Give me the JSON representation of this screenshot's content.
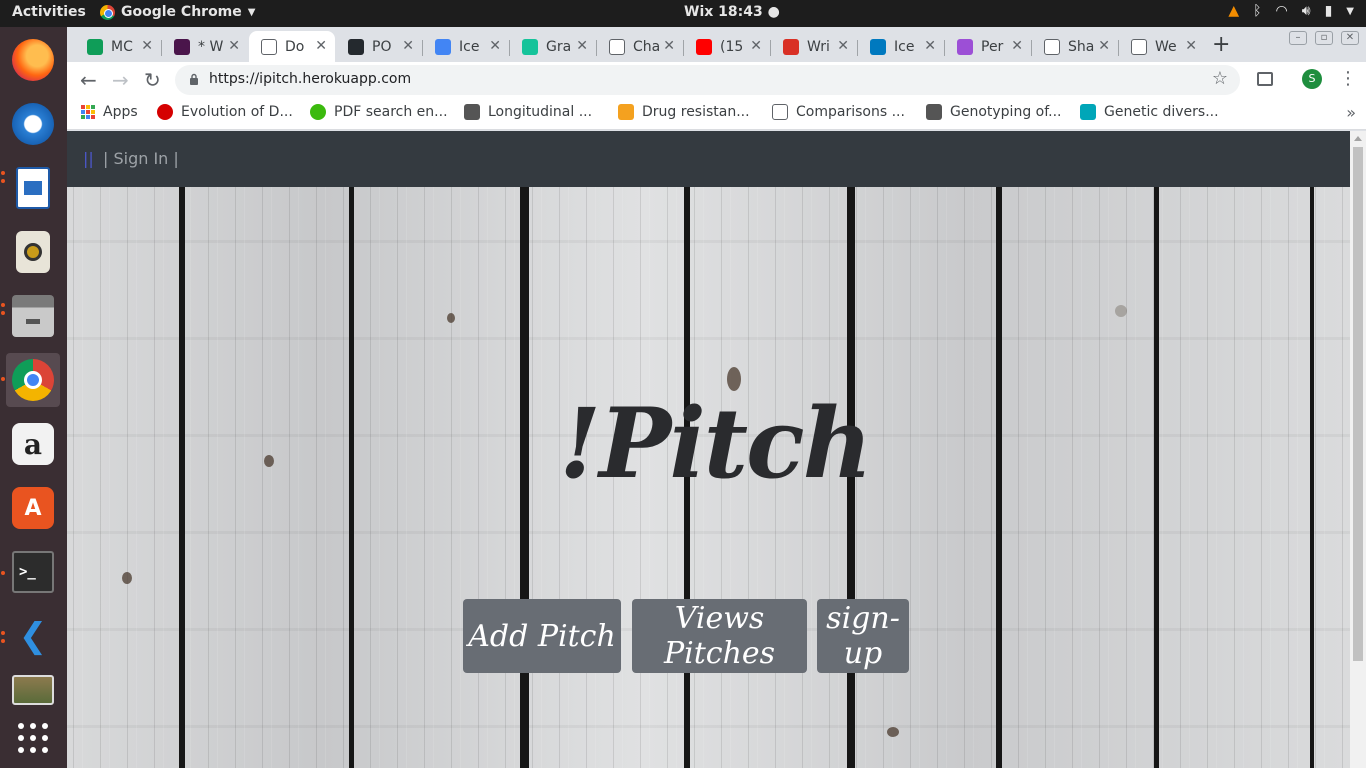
{
  "topbar": {
    "activities": "Activities",
    "app_name": "Google Chrome",
    "clock": "Wix 18:43 ●"
  },
  "dock": {
    "items": [
      "firefox",
      "thunderbird",
      "libreoffice-writer",
      "rhythmbox",
      "files",
      "chrome",
      "amazon",
      "software-center",
      "terminal",
      "vscode",
      "shotwell",
      "show-apps"
    ]
  },
  "tabs": [
    {
      "title": "MC",
      "icon": "green-plus-icon",
      "color": "#0f9d58"
    },
    {
      "title": "* W",
      "icon": "slack-icon",
      "color": "#4a154b"
    },
    {
      "title": "Do",
      "icon": "document-icon",
      "color": "#ffffff",
      "active": true
    },
    {
      "title": "PO",
      "icon": "github-icon",
      "color": "#24292e"
    },
    {
      "title": "Ice",
      "icon": "docs-icon",
      "color": "#4285f4"
    },
    {
      "title": "Gra",
      "icon": "grammarly-icon",
      "color": "#15c39a"
    },
    {
      "title": "Cha",
      "icon": "document-icon",
      "color": "#ffffff"
    },
    {
      "title": "(15",
      "icon": "youtube-icon",
      "color": "#ff0000"
    },
    {
      "title": "Wri",
      "icon": "write-icon",
      "color": "#d93025"
    },
    {
      "title": "Ice",
      "icon": "trello-icon",
      "color": "#0079bf"
    },
    {
      "title": "Per",
      "icon": "h-icon",
      "color": "#9c4fd6"
    },
    {
      "title": "Sha",
      "icon": "document-icon",
      "color": "#ffffff"
    },
    {
      "title": "We",
      "icon": "document-icon",
      "color": "#ffffff"
    }
  ],
  "toolbar": {
    "url": "https://ipitch.herokuapp.com",
    "profile_initial": "S"
  },
  "bookmarks": [
    {
      "label": "Apps",
      "icon": "apps-grid-icon",
      "color": "#ea4335"
    },
    {
      "label": "Evolution of D...",
      "icon": "red-circle-icon",
      "color": "#d50000"
    },
    {
      "label": "PDF search en...",
      "icon": "green-face-icon",
      "color": "#3bba0e"
    },
    {
      "label": "Longitudinal ...",
      "icon": "s-curve-icon",
      "color": "#555555"
    },
    {
      "label": "Drug resistan...",
      "icon": "e-icon",
      "color": "#f4a11f"
    },
    {
      "label": "Comparisons ...",
      "icon": "document-icon",
      "color": "#ffffff"
    },
    {
      "label": "Genotyping of...",
      "icon": "s-curve-icon",
      "color": "#555555"
    },
    {
      "label": "Genetic divers...",
      "icon": "triangle-icon",
      "color": "#00a6b8"
    }
  ],
  "site": {
    "brand": "||",
    "signin": "| Sign In |",
    "logo": "!Pitch",
    "buttons": {
      "add": "Add Pitch",
      "views": "Views Pitches",
      "signup": "sign-up"
    }
  }
}
